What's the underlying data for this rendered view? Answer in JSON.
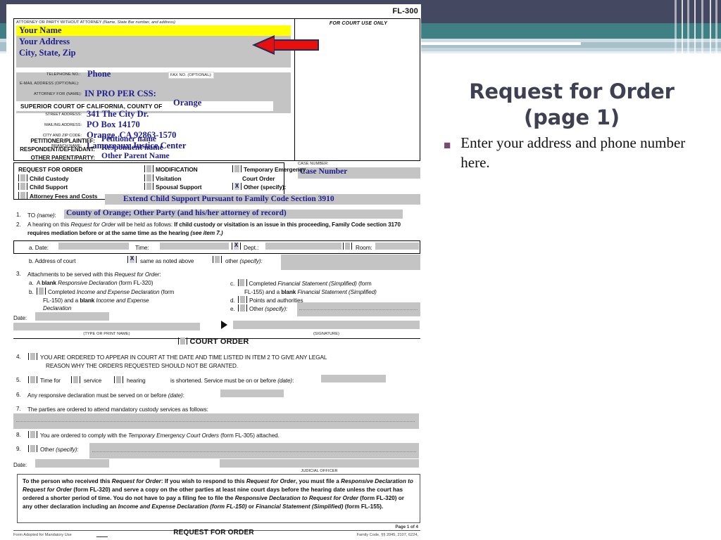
{
  "slide": {
    "title_line1": "Request for Order",
    "title_line2": "(page 1)",
    "bullets": [
      "Enter your address and phone number here."
    ],
    "accent_dark": "#454861",
    "accent_teal": "#3e8083",
    "accent_light": "#a7c1cb",
    "bullet_color": "#7a4a72"
  },
  "form": {
    "form_number": "FL-300",
    "caption": {
      "attorney_label": "ATTORNEY OR PARTY WITHOUT ATTORNEY",
      "attorney_label_italic": "(Name, State Bar number, and address)",
      "name": "Your Name",
      "address": "Your Address",
      "city_state_zip": "City, State, Zip",
      "telephone_label": "TELEPHONE NO.:",
      "telephone_value": "Phone",
      "fax_label": "FAX NO. (Optional):",
      "email_label": "E-MAIL ADDRESS (Optional):",
      "attorney_for_label": "ATTORNEY FOR (Name):",
      "attorney_for_value": "IN PRO PER     CSS:",
      "court_use_only": "FOR COURT USE ONLY",
      "superior_court": "SUPERIOR COURT OF CALIFORNIA, COUNTY OF",
      "county": "Orange",
      "street_address_label": "STREET ADDRESS:",
      "street_address": "341 The City Dr.",
      "mailing_address_label": "MAILING ADDRESS:",
      "mailing_address": "PO Box 14170",
      "city_zip_label": "CITY AND ZIP CODE:",
      "city_zip": "Orange, CA  92863-1570",
      "branch_name_label": "BRANCH NAME:",
      "branch_name": "Lamoreaux Justice Center",
      "petitioner_label": "PETITIONER/PLAINTIFF:",
      "petitioner": "Petitioner name",
      "respondent_label": "RESPONDENT/DEFENDANT:",
      "respondent": "Respondent name",
      "other_parent_label": "OTHER PARENT/PARTY:",
      "other_parent": "Other Parent Name",
      "case_number_label": "CASE NUMBER:",
      "case_number": "Case Number"
    },
    "request_box": {
      "col1": [
        {
          "label": "REQUEST FOR ORDER",
          "checkbox": false,
          "checked": false
        },
        {
          "label": "Child Custody",
          "checkbox": true,
          "checked": false
        },
        {
          "label": "Child Support",
          "checkbox": true,
          "checked": false
        },
        {
          "label": "Attorney Fees and Costs",
          "checkbox": true,
          "checked": false
        }
      ],
      "col2": [
        {
          "label": "MODIFICATION",
          "checkbox": true,
          "checked": false
        },
        {
          "label": "Visitation",
          "checkbox": true,
          "checked": false
        },
        {
          "label": "Spousal Support",
          "checkbox": true,
          "checked": false
        }
      ],
      "col3": [
        {
          "label": "Temporary Emergency",
          "checkbox": true,
          "checked": false
        },
        {
          "label": "Court Order",
          "checkbox": false,
          "checked": false
        },
        {
          "label": "Other (specify):",
          "checkbox": true,
          "checked": true
        }
      ],
      "other_value": "Extend Child Support Pursuant to Family Code Section 3910"
    },
    "item1": {
      "num": "1.",
      "label": "TO (name):",
      "value": "County of Orange; Other Party (and his/her attorney of record)"
    },
    "item2": {
      "num": "2.",
      "text_a": "A hearing on this ",
      "text_italic": "Request for Order",
      "text_b": " will be held as follows: ",
      "text_bold": "If child custody or visitation is an issue in this proceeding, Family Code section 3170 requires mediation before or at the same time as the hearing ",
      "text_see": "(see item 7.)",
      "a_label": "a.  Date:",
      "time_label": "Time:",
      "dept_label": "Dept.:",
      "dept_checked": true,
      "room_label": "Room:",
      "room_checked": false,
      "b_label": "b.  Address of court",
      "same_as_above": "same as noted above",
      "same_checked": true,
      "other": "other (specify):",
      "other_checked": false
    },
    "item3": {
      "num": "3.",
      "heading_a": "Attachments to be served with this ",
      "heading_i": "Request for Order",
      "heading_b": ":",
      "a": "a.  A blank Responsive Declaration (form FL-320)",
      "b": "b.  Completed Income and Expense Declaration (form FL-150) and a blank Income and Expense Declaration",
      "c": "c.  Completed Financial Statement (Simplified) (form FL-155) and a blank Financial Statement (Simplified)",
      "d": "d.  Points and authorities",
      "e": "e.  Other (specify):"
    },
    "signature": {
      "date_label": "Date:",
      "type_or_print": "(TYPE OR PRINT NAME)",
      "signature_label": "(SIGNATURE)"
    },
    "court_order_heading": "COURT ORDER",
    "orders": [
      {
        "num": "4.",
        "checkbox": true,
        "text": "YOU ARE ORDERED TO APPEAR IN COURT AT THE DATE AND TIME LISTED IN ITEM 2 TO GIVE ANY LEGAL REASON WHY THE ORDERS REQUESTED SHOULD NOT BE GRANTED."
      },
      {
        "num": "5.",
        "checkbox": true,
        "text": "Time for  service  hearing  is shortened. Service must be on or before (date):"
      },
      {
        "num": "6.",
        "checkbox": false,
        "text": "Any responsive declaration must be served on or before (date):"
      },
      {
        "num": "7.",
        "checkbox": false,
        "text": "The parties are ordered to attend mandatory custody services as follows:"
      },
      {
        "num": "8.",
        "checkbox": true,
        "text": "You are ordered to comply with the Temporary Emergency Court Orders (form FL-305) attached."
      },
      {
        "num": "9.",
        "checkbox": true,
        "text": "Other (specify):"
      }
    ],
    "item5_parts": {
      "time_for": "Time for",
      "service": "service",
      "hearing": "hearing",
      "tail": "is shortened. Service must be on or before (date):"
    },
    "item6_text": "Any responsive declaration must be served on or before (date):",
    "item7_text": "The parties are ordered to attend mandatory custody services as follows:",
    "item8_a": "You are ordered to comply with the ",
    "item8_i": "Temporary Emergency Court Orders",
    "item8_b": " (form FL-305) attached.",
    "item9_a": "Other ",
    "item9_i": "(specify):",
    "bottom_date_label": "Date:",
    "judicial_officer": "JUDICIAL OFFICER",
    "notice": {
      "l1_b": "To the person who received this ",
      "l1_i": "Request for Order",
      "l1_c": ": If you wish to respond to this ",
      "l1_i2": "Request for Order",
      "l1_d": ", you must file a ",
      "l2_i": "Responsive Declaration to Request for Order",
      "l2_t": " (form FL-320) and serve a copy on the other parties at least nine court days before the hearing date unless the court has ordered a shorter period of time. You do not have to pay a filing fee to file the ",
      "l3_i": "Responsive Declaration to Request for Order",
      "l3_t": " (form FL-320) or any other declaration including an ",
      "l4_i": "Income and Expense Declaration (form FL-150)",
      "l4_t": " or ",
      "l5_i": "Financial Statement (Simplified)",
      "l5_t": " (form FL-155)."
    },
    "footer": {
      "left": "Form Adopted for Mandatory Use",
      "center": "REQUEST FOR ORDER",
      "right": "Family Code, §§ 2045, 2107, 6224,",
      "page": "Page 1 of 4"
    }
  }
}
